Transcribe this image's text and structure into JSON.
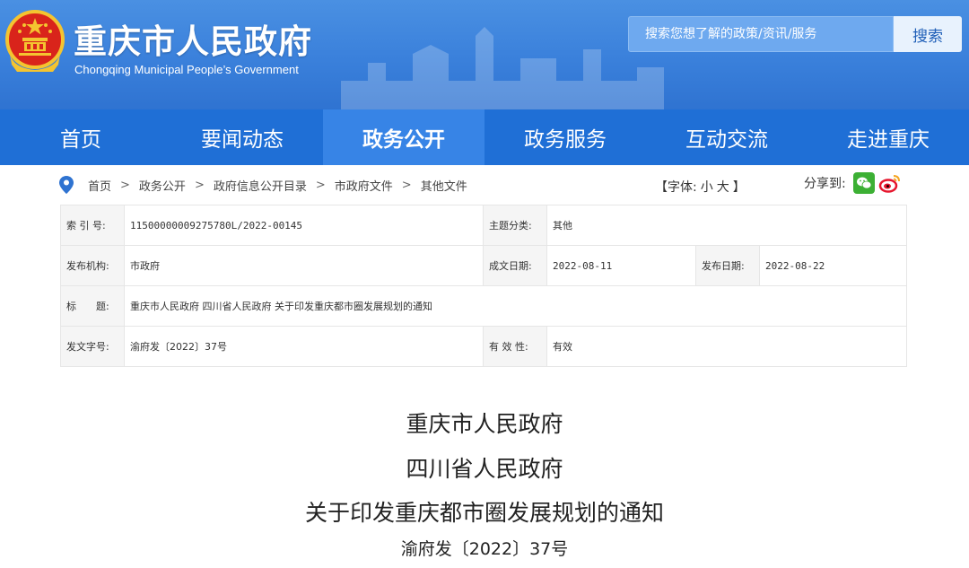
{
  "header": {
    "title_cn": "重庆市人民政府",
    "title_en": "Chongqing Municipal People’s Government",
    "search_placeholder": "搜索您想了解的政策/资讯/服务",
    "search_button": "搜索"
  },
  "nav": [
    {
      "label": "首页",
      "active": false
    },
    {
      "label": "要闻动态",
      "active": false
    },
    {
      "label": "政务公开",
      "active": true
    },
    {
      "label": "政务服务",
      "active": false
    },
    {
      "label": "互动交流",
      "active": false
    },
    {
      "label": "走进重庆",
      "active": false
    }
  ],
  "breadcrumb": [
    "首页",
    "政务公开",
    "政府信息公开目录",
    "市政府文件",
    "其他文件"
  ],
  "breadcrumb_sep": ">",
  "font_size": {
    "open": "【字体:",
    "small": "小",
    "large": "大",
    "close": "】"
  },
  "share": {
    "label": "分享到:",
    "wechat_icon": "wechat-icon",
    "weibo_icon": "weibo-icon"
  },
  "meta": {
    "index_label": "索 引 号:",
    "index_value": "11500000009275780L/2022-00145",
    "category_label": "主题分类:",
    "category_value": "其他",
    "issuer_label": "发布机构:",
    "issuer_value": "市政府",
    "written_label": "成文日期:",
    "written_value": "2022-08-11",
    "published_label": "发布日期:",
    "published_value": "2022-08-22",
    "title_label": "标　　题:",
    "title_value": "重庆市人民政府 四川省人民政府 关于印发重庆都市圈发展规划的通知",
    "docno_label": "发文字号:",
    "docno_value": "渝府发〔2022〕37号",
    "validity_label": "有 效 性:",
    "validity_value": "有效"
  },
  "document": {
    "line1": "重庆市人民政府",
    "line2": "四川省人民政府",
    "line3": "关于印发重庆都市圈发展规划的通知",
    "number": "渝府发〔2022〕37号"
  },
  "colors": {
    "header_blue": "#3a80db",
    "nav_blue": "#1f6fd6",
    "nav_active": "#3784e6",
    "label_bg": "#f5f5f5"
  }
}
